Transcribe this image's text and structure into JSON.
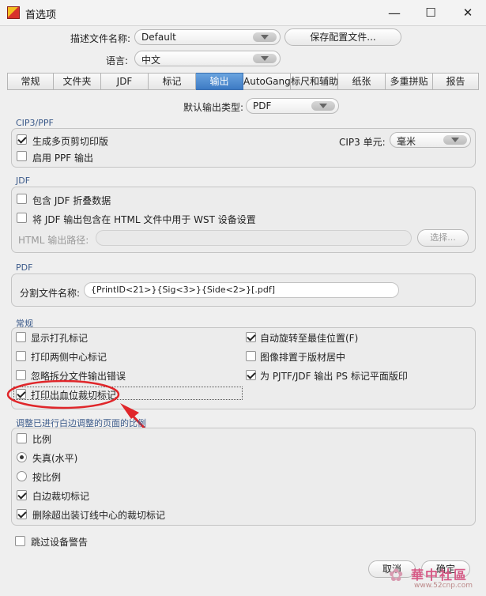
{
  "window": {
    "title": "首选项",
    "minimize": "—",
    "maximize": "☐",
    "close": "✕"
  },
  "top": {
    "profile_label": "描述文件名称:",
    "profile_value": "Default",
    "save_button": "保存配置文件...",
    "language_label": "语言:",
    "language_value": "中文"
  },
  "tabs": [
    "常规",
    "文件夹",
    "JDF",
    "标记",
    "输出",
    "AutoGang",
    "标尺和辅助",
    "纸张",
    "多重拼贴",
    "报告"
  ],
  "output_type": {
    "label": "默认输出类型:",
    "value": "PDF"
  },
  "cip3": {
    "title": "CIP3/PPF",
    "gen_multi": "生成多页剪切印版",
    "gen_multi_checked": true,
    "enable_ppf": "启用 PPF 输出",
    "enable_ppf_checked": false,
    "unit_label": "CIP3 单元:",
    "unit_value": "毫米"
  },
  "jdf": {
    "title": "JDF",
    "fold_data": "包含 JDF 折叠数据",
    "fold_checked": false,
    "embed_html": "将 JDF 输出包含在 HTML 文件中用于 WST 设备设置",
    "embed_checked": false,
    "html_path_label": "HTML 输出路径:",
    "html_path_value": "",
    "choose_button": "选择..."
  },
  "pdf": {
    "title": "PDF",
    "split_label": "分割文件名称:",
    "split_value": "{PrintID<21>}{Sig<3>}{Side<2>}[.pdf]"
  },
  "general": {
    "title": "常规",
    "left": [
      {
        "label": "显示打孔标记",
        "checked": false
      },
      {
        "label": "打印两侧中心标记",
        "checked": false
      },
      {
        "label": "忽略拆分文件输出错误",
        "checked": false
      },
      {
        "label": "打印出血位裁切标记",
        "checked": true
      }
    ],
    "right": [
      {
        "label": "自动旋转至最佳位置(F)",
        "checked": true
      },
      {
        "label": "图像排置于版材居中",
        "checked": false
      },
      {
        "label": "为 PJTF/JDF 输出 PS 标记平面版印",
        "checked": true
      }
    ]
  },
  "scale": {
    "title": "调整已进行白边调整的页面的比例",
    "ratio": "比例",
    "ratio_checked": false,
    "distort": "失真(水平)",
    "distort_selected": true,
    "proportional": "按比例",
    "proportional_selected": false,
    "white_crop": "白边裁切标记",
    "white_crop_checked": true,
    "delete_crop": "删除超出装订线中心的裁切标记",
    "delete_crop_checked": true
  },
  "skip_warning": {
    "label": "跳过设备警告",
    "checked": false
  },
  "footer": {
    "cancel": "取消",
    "ok": "确定"
  },
  "watermark": {
    "text": "華中社區",
    "url": "www.52cnp.com"
  },
  "colors": {
    "accent": "#3d7ac4",
    "annotation": "#e0262a"
  }
}
